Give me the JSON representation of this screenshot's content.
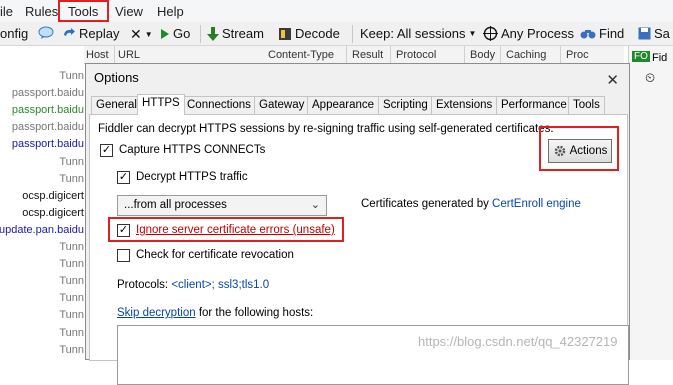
{
  "menubar": {
    "items": [
      "Rules",
      "Tools",
      "View",
      "Help"
    ],
    "partial_first": "ile"
  },
  "toolbar": {
    "config_label": "onfig",
    "replay_label": "Replay",
    "remove_label": "✕",
    "go_label": "Go",
    "stream_label": "Stream",
    "decode_label": "Decode",
    "keep_label": "Keep: All sessions",
    "any_process_label": "Any Process",
    "find_label": "Find",
    "save_label": "Sa"
  },
  "grid": {
    "headers": [
      "Host",
      "URL",
      "Content-Type",
      "Result",
      "Protocol",
      "Body",
      "Caching",
      "Proc"
    ],
    "sessions": [
      {
        "host": "Tunn",
        "color": "#777777"
      },
      {
        "host": "passport.baidu",
        "color": "#777777"
      },
      {
        "host": "passport.baidu",
        "color": "#2a8a2a"
      },
      {
        "host": "passport.baidu",
        "color": "#777777"
      },
      {
        "host": "passport.baidu",
        "color": "#1a1aa6"
      },
      {
        "host": "Tunn",
        "color": "#777777"
      },
      {
        "host": "Tunn",
        "color": "#777777"
      },
      {
        "host": "ocsp.digicert",
        "color": "#111111"
      },
      {
        "host": "ocsp.digicert",
        "color": "#111111"
      },
      {
        "host": "update.pan.baidu",
        "color": "#1a1aa6"
      },
      {
        "host": "Tunn",
        "color": "#777777"
      },
      {
        "host": "Tunn",
        "color": "#777777"
      },
      {
        "host": "Tunn",
        "color": "#777777"
      },
      {
        "host": "Tunn",
        "color": "#777777"
      },
      {
        "host": "Tunn",
        "color": "#777777"
      },
      {
        "host": "Tunn",
        "color": "#777777"
      },
      {
        "host": "Tunn",
        "color": "#777777"
      }
    ],
    "right_panel_label": "Fid"
  },
  "dialog": {
    "title": "Options",
    "close": "✕",
    "tabs": [
      "General",
      "HTTPS",
      "Connections",
      "Gateway",
      "Appearance",
      "Scripting",
      "Extensions",
      "Performance",
      "Tools"
    ],
    "active_tab": "HTTPS",
    "description": "Fiddler can decrypt HTTPS sessions by re-signing traffic using self-generated certificates.",
    "capture_https": {
      "label": "Capture HTTPS CONNECTs",
      "checked": true
    },
    "decrypt_https": {
      "label": "Decrypt HTTPS traffic",
      "checked": true
    },
    "from_select": {
      "value": "...from all processes"
    },
    "certs_generated_prefix": "Certificates generated by ",
    "certs_generated_link": "CertEnroll engine",
    "ignore_errors": {
      "label": "Ignore server certificate errors (unsafe)",
      "checked": true
    },
    "check_revocation": {
      "label": "Check for certificate revocation",
      "checked": false
    },
    "protocols_label": "Protocols: ",
    "protocols_value": "<client>; ssl3;tls1.0",
    "skip_link": "Skip decryption",
    "skip_suffix": " for the following hosts:",
    "actions_button": "Actions"
  },
  "watermark": "https://blog.csdn.net/qq_42327219",
  "colors": {
    "highlight_red": "#e02020",
    "link_blue": "#0645ad"
  }
}
